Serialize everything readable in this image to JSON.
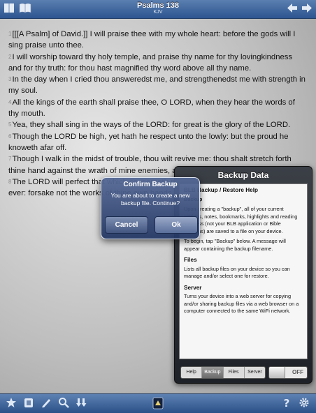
{
  "header": {
    "title": "Psalms 138",
    "version": "KJV"
  },
  "verses": [
    {
      "num": "1",
      "text": "[[[A Psalm] of David.]] I will praise thee with my whole heart: before the gods will I sing praise unto thee."
    },
    {
      "num": "2",
      "text": "I will worship toward thy holy temple, and praise thy name for thy lovingkindness and for thy truth: for thou hast magnified thy word above all thy name."
    },
    {
      "num": "3",
      "text": "In the day when I cried thou answeredst me, and strengthenedst me with strength in my soul."
    },
    {
      "num": "4",
      "text": "All the kings of the earth shall praise thee, O LORD, when they hear the words of thy mouth."
    },
    {
      "num": "5",
      "text": "Yea, they shall sing in the ways of the LORD: for great is the glory of the LORD."
    },
    {
      "num": "6",
      "text": "Though the LORD be high, yet hath he respect unto the lowly: but the proud he knoweth afar off."
    },
    {
      "num": "7",
      "text": "Though I walk in the midst of trouble, thou wilt revive me: thou shalt stretch forth thine hand against the wrath of mine enemies, and thy"
    },
    {
      "num": "8",
      "text": "The LORD will perfect that which concerneth me: thy mercy, O LORD, endureth for ever: forsake not the works of thine own hands."
    }
  ],
  "backup_panel": {
    "title": "Backup Data",
    "sections": [
      {
        "heading": "BLB Backup / Restore Help",
        "paragraphs": [
          "Backup",
          "Upon creating a \"backup\", all of your current settings, notes, bookmarks, highlights and reading progress (not your BLB application or Bible Versions) are saved to a file on your device.",
          "To begin, tap \"Backup\" below. A message will appear containing the backup filename."
        ]
      },
      {
        "heading": "Files",
        "paragraphs": [
          "Lists all backup files on your device so you can manage and/or select one for restore."
        ]
      },
      {
        "heading": "Server",
        "paragraphs": [
          "Turns your device into a web server for copying and/or sharing backup files via a web browser on a computer connected to the same WiFi network."
        ]
      }
    ],
    "tabs": [
      "Help",
      "Backup",
      "Files",
      "Server"
    ],
    "active_tab": "Backup",
    "server_toggle": "OFF"
  },
  "alert": {
    "title": "Confirm Backup",
    "message": "You are about to create a new backup file. Continue?",
    "cancel_label": "Cancel",
    "ok_label": "Ok"
  },
  "icons": {
    "top_left": [
      "bible-icon",
      "book-icon"
    ],
    "top_right": [
      "back-arrow-icon",
      "forward-arrow-icon"
    ],
    "bottom_left": [
      "star-icon",
      "notes-icon",
      "pen-icon",
      "search-icon",
      "download-icon"
    ],
    "bottom_center": "app-logo-icon",
    "bottom_right": [
      "help-icon",
      "gear-icon"
    ]
  }
}
